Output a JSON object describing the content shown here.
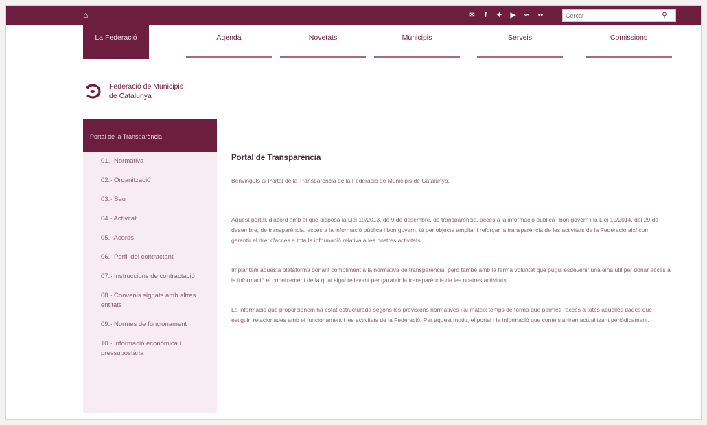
{
  "topbar": {
    "home_icon": "home-icon",
    "social_icons": [
      "email-icon",
      "facebook-icon",
      "twitter-icon",
      "youtube-icon",
      "rss-icon",
      "flickr-icon"
    ],
    "search_placeholder": "Cercar",
    "search_icon": "search-icon"
  },
  "nav": {
    "items": [
      {
        "label": "La Federació",
        "active": true
      },
      {
        "label": "Agenda",
        "active": false
      },
      {
        "label": "Novetats",
        "active": false
      },
      {
        "label": "Municipis",
        "active": false
      },
      {
        "label": "Serveis",
        "active": false
      },
      {
        "label": "Comissions",
        "active": false
      }
    ]
  },
  "logo": {
    "line1": "Federació de Municipis",
    "line2": "de Catalunya"
  },
  "sidebar": {
    "title": "Portal de la Transparència",
    "items": [
      "01.- Normativa",
      "02.- Organització",
      "03.- Seu",
      "04.- Activitat",
      "05.- Acords",
      "06.- Perfil del contractant",
      "07.- Instruccions de contractació",
      "08.- Convenis signats amb altres entitats",
      "09.- Normes de funcionament",
      "10.- Informació econòmica i pressupostària"
    ]
  },
  "main": {
    "title": "Portal de Transparència",
    "intro": "Benvinguts al Portal de la Transparència de la Federació de Municipis de Catalunya.",
    "paragraphs": [
      "Aquest portal, d'acord amb el que disposa la Llei 19/2013, de 9 de desembre, de transparència, accés a la informació pública i bon govern i la Llei 19/2014, del 29 de desembre, de transparència, accés a la informació pública i bon govern, té per objecte ampliar i reforçar la transparència de les activitats de la Federació així com garantir el dret d'accés a tota la informació relativa a les nostres activitats.",
      "Implantem aquesta plataforma donant compliment a la normativa de transparència, però també amb la ferma voluntat que pugui esdevenir una eina útil per donar accés a la informació el coneixement de la qual sigui rellevant per garantir la transparència de les nostres activitats.",
      "La informació que proporcionem ha estat estructurada segons les previsions normatives i al mateix temps de forma que permeti l'accés a totes aquelles dades que estiguin relacionades amb el funcionament i les activitats de la Federació. Per aquest motiu, el portal i la informació que conté s'aniran actualitzant periòdicament."
    ]
  },
  "colors": {
    "brand": "#6d1e3f",
    "sidebar_bg": "#f7ecf1",
    "text": "#8c5e74"
  }
}
